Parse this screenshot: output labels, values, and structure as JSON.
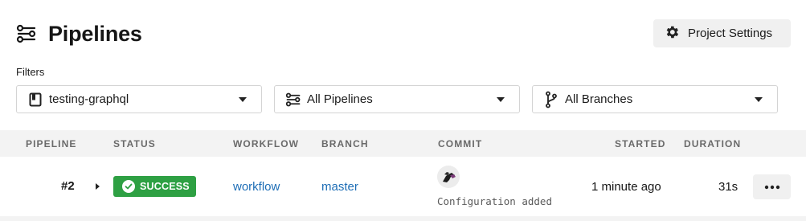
{
  "header": {
    "title": "Pipelines",
    "title_icon": "pipelines-icon"
  },
  "settings_button": {
    "label": "Project Settings",
    "icon": "gear-icon"
  },
  "filters": {
    "label": "Filters",
    "project": {
      "value": "testing-graphql",
      "icon": "project-icon"
    },
    "pipeline": {
      "value": "All Pipelines",
      "icon": "pipelines-icon"
    },
    "branch": {
      "value": "All Branches",
      "icon": "branch-icon"
    }
  },
  "table": {
    "columns": [
      "PIPELINE",
      "STATUS",
      "WORKFLOW",
      "BRANCH",
      "COMMIT",
      "STARTED",
      "DURATION"
    ],
    "rows": [
      {
        "pipeline": "#2",
        "status": "SUCCESS",
        "workflow": "workflow",
        "branch": "master",
        "commit_message": "Configuration added",
        "started": "1 minute ago",
        "duration": "31s"
      }
    ]
  },
  "colors": {
    "success": "#2ea043",
    "link": "#1e6eb6",
    "header_bg": "#f3f3f3",
    "button_bg": "#f0f0f0"
  }
}
